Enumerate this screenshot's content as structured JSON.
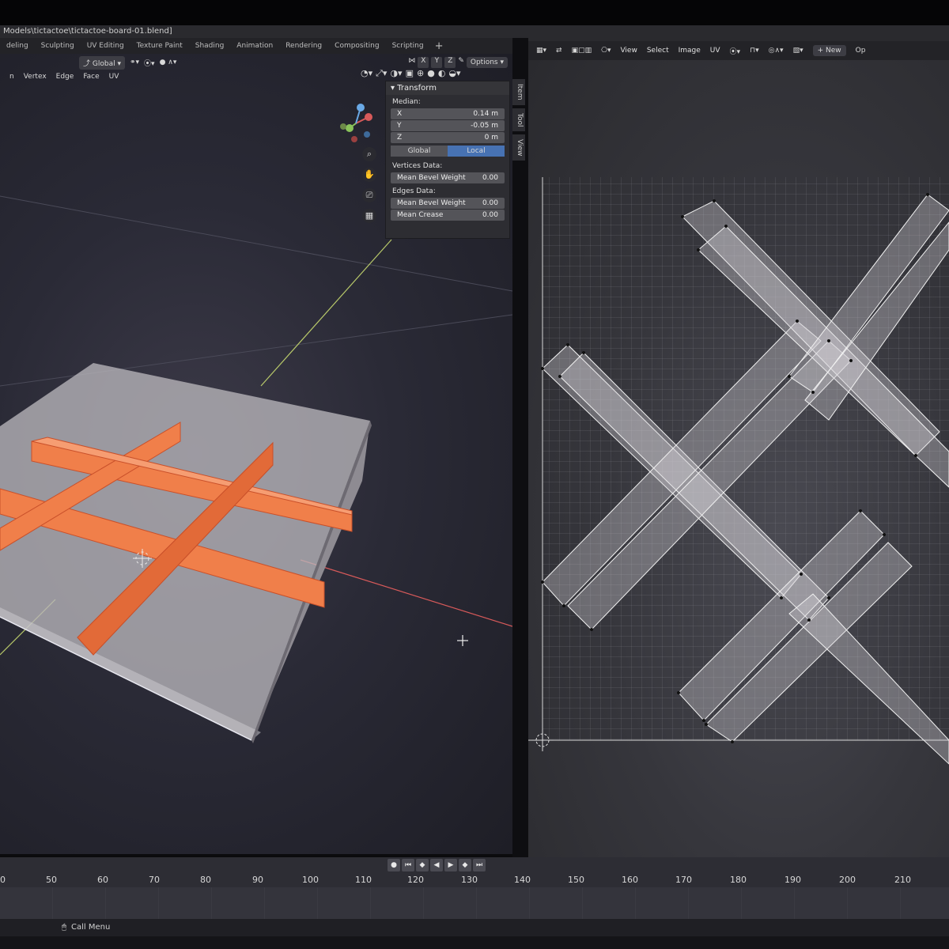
{
  "window": {
    "title": "Models\\tictactoe\\tictactoe-board-01.blend]"
  },
  "workspace_tabs": [
    "deling",
    "Sculpting",
    "UV Editing",
    "Texture Paint",
    "Shading",
    "Animation",
    "Rendering",
    "Compositing",
    "Scripting",
    "+"
  ],
  "viewport": {
    "orientation": "Global",
    "mode_menu": [
      "n",
      "Vertex",
      "Edge",
      "Face",
      "UV"
    ],
    "axis_buttons": [
      "X",
      "Y",
      "Z"
    ],
    "options_label": "Options"
  },
  "transform_panel": {
    "header": "Transform",
    "median_label": "Median:",
    "x_label": "X",
    "x_value": "0.14 m",
    "y_label": "Y",
    "y_value": "-0.05 m",
    "z_label": "Z",
    "z_value": "0 m",
    "global_label": "Global",
    "local_label": "Local",
    "vertices_data_label": "Vertices Data:",
    "vertex_bevel_label": "Mean Bevel Weight",
    "vertex_bevel_value": "0.00",
    "edges_data_label": "Edges Data:",
    "edge_bevel_label": "Mean Bevel Weight",
    "edge_bevel_value": "0.00",
    "crease_label": "Mean Crease",
    "crease_value": "0.00"
  },
  "side_tabs": [
    "Item",
    "Tool",
    "View"
  ],
  "uv_editor": {
    "menus": [
      "View",
      "Select",
      "Image",
      "UV"
    ],
    "new_label": "+ New",
    "options_cut": "Op"
  },
  "timeline": {
    "frames": [
      "0",
      "50",
      "60",
      "70",
      "80",
      "90",
      "100",
      "110",
      "120",
      "130",
      "140",
      "150",
      "160",
      "170",
      "180",
      "190",
      "200",
      "210"
    ]
  },
  "status": {
    "call_menu": "Call Menu"
  },
  "colors": {
    "selected_orange": "#f07f4a",
    "uv_grid": "#9a9aa2",
    "accent_blue": "#4772b3"
  }
}
